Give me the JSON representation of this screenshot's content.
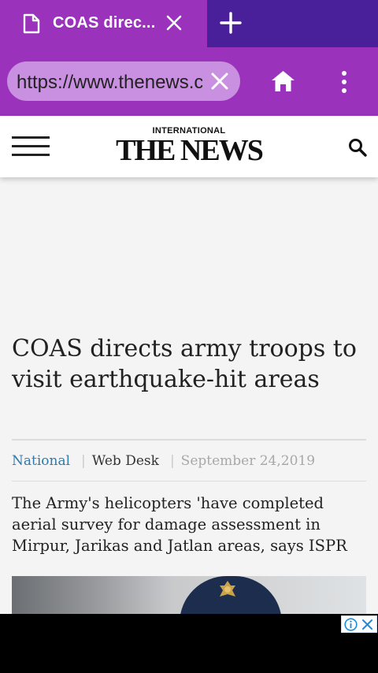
{
  "browser": {
    "tab_title": "COAS direc...",
    "url": "https://www.thenews.com.pk",
    "page_load_progress": 0.89,
    "accent_color": "#9a32bb",
    "tabstrip_color": "#4a1f9a"
  },
  "site": {
    "logo_top": "INTERNATIONAL",
    "logo_main": "THE NEWS"
  },
  "article": {
    "headline": "COAS directs army troops to visit earthquake-hit areas",
    "category": "National",
    "author": "Web Desk",
    "date": "September 24,2019",
    "summary": "The Army's helicopters 'have completed aerial survey for damage assessment in Mirpur, Jarikas and Jatlan areas, says ISPR",
    "category_color": "#2e79a8"
  },
  "icons": {
    "tab": "document-icon",
    "tab_close": "close-icon",
    "new_tab": "plus-icon",
    "url_clear": "clear-icon",
    "home": "home-icon",
    "overflow_menu": "more-vert-icon",
    "site_menu": "hamburger-icon",
    "site_search": "search-icon",
    "ad_info": "info-icon",
    "ad_close": "close-icon"
  }
}
